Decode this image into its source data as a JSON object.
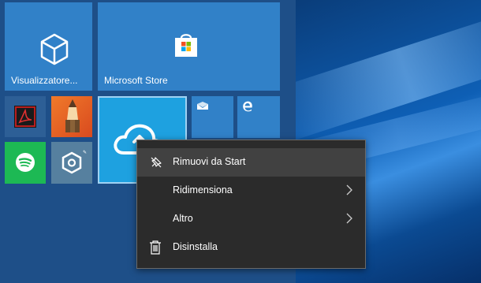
{
  "start_menu": {
    "tiles": [
      {
        "name": "viewer",
        "label": "Visualizzatore..."
      },
      {
        "name": "store",
        "label": "Microsoft Store"
      }
    ]
  },
  "context_menu": {
    "items": [
      {
        "label": "Rimuovi da Start",
        "icon": "unpin-icon"
      },
      {
        "label": "Ridimensiona",
        "icon": "chevron-right-icon"
      },
      {
        "label": "Altro",
        "icon": "chevron-right-icon"
      },
      {
        "label": "Disinstalla",
        "icon": "trash-icon"
      }
    ]
  },
  "colors": {
    "tile": "#3181c8",
    "start_bg": "#1e4f88",
    "menu_bg": "#2b2b2b",
    "menu_highlight": "#414141"
  }
}
